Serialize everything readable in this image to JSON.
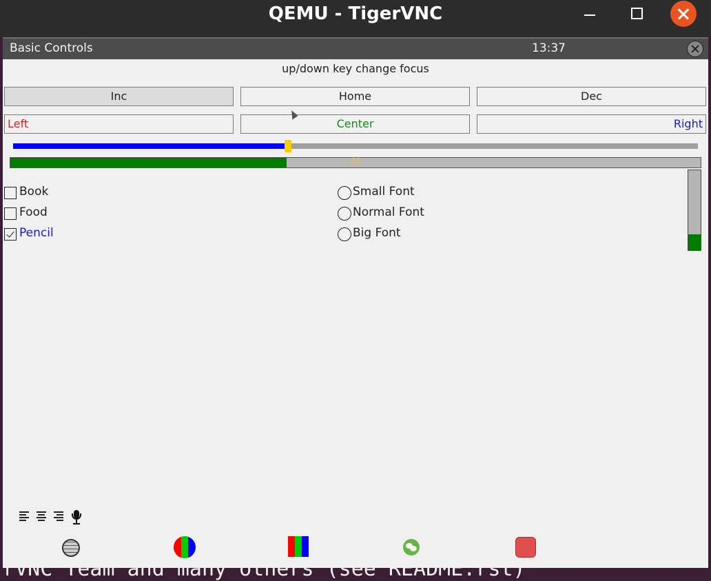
{
  "window": {
    "title": "QEMU - TigerVNC"
  },
  "background_terminal": {
    "text": "rVNC Team and many others (see README.rst)"
  },
  "app": {
    "title": "Basic Controls",
    "clock": "13:37",
    "hint": "up/down key change focus"
  },
  "buttons_row1": [
    {
      "label": "Inc",
      "pressed": true
    },
    {
      "label": "Home",
      "pressed": false
    },
    {
      "label": "Dec",
      "pressed": false
    }
  ],
  "buttons_row2": [
    {
      "label": "Left",
      "align": "left",
      "color": "#dd2222"
    },
    {
      "label": "Center",
      "align": "center",
      "color": "#1a8a1a"
    },
    {
      "label": "Right",
      "align": "right",
      "color": "#1a1acc"
    }
  ],
  "slider": {
    "value": 40,
    "min": 0,
    "max": 100,
    "fill_color": "#0000ff",
    "thumb_color": "#ffcc00"
  },
  "progress": {
    "value": 40,
    "text": "40",
    "fill_color": "#007d00"
  },
  "vertical_bar": {
    "value": 20,
    "fill_color": "#007d00"
  },
  "checkboxes": [
    {
      "label": "Book",
      "checked": false
    },
    {
      "label": "Food",
      "checked": false
    },
    {
      "label": "Pencil",
      "checked": true
    }
  ],
  "radios": [
    {
      "label": "Small Font",
      "selected": false
    },
    {
      "label": "Normal Font",
      "selected": false
    },
    {
      "label": "Big Font",
      "selected": false
    }
  ],
  "toolbar_icons": [
    "align-left-icon",
    "align-center-icon",
    "align-right-icon",
    "microphone-icon"
  ],
  "dock_icons": [
    "globe-icon",
    "rgb-circle-icon",
    "rgb-bars-icon",
    "wechat-icon",
    "stop-icon"
  ]
}
